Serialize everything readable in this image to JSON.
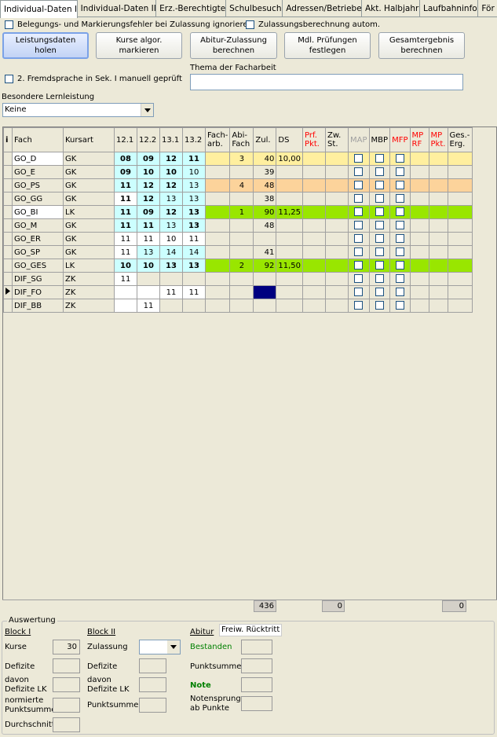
{
  "tabs": [
    "Individual-Daten I",
    "Individual-Daten II",
    "Erz.-Berechtigte",
    "Schulbesuch",
    "Adressen/Betriebe",
    "Akt. Halbjahr",
    "Laufbahninfo",
    "För"
  ],
  "options": {
    "ignore_errors": "Belegungs- und Markierungsfehler bei Zulassung ignorieren",
    "auto_calc": "Zulassungsberechnung autom."
  },
  "buttons": {
    "fetch": "Leistungsdaten holen",
    "mark_l1": "Kurse algor.",
    "mark_l2": "markieren",
    "admission_l1": "Abitur-Zulassung",
    "admission_l2": "berechnen",
    "oral_l1": "Mdl. Prüfungen",
    "oral_l2": "festlegen",
    "total_l1": "Gesamtergebnis",
    "total_l2": "berechnen"
  },
  "thesis_label": "Thema der Facharbeit",
  "thesis_value": "",
  "second_lang": "2. Fremdsprache in Sek. I manuell geprüft",
  "special_label": "Besondere Lernleistung",
  "special_value": "Keine",
  "grid": {
    "headers": {
      "i": "i",
      "fach": "Fach",
      "kursart": "Kursart",
      "h121": "12.1",
      "h122": "12.2",
      "h131": "13.1",
      "h132": "13.2",
      "facharb_1": "Fach-",
      "facharb_2": "arb.",
      "abifach_1": "Abi-",
      "abifach_2": "Fach",
      "zul": "Zul.",
      "ds": "DS",
      "prf_1": "Prf.",
      "prf_2": "Pkt.",
      "zw_1": "Zw.",
      "zw_2": "St.",
      "map": "MAP",
      "mbp": "MBP",
      "mfp": "MFP",
      "mprf_1": "MP",
      "mprf_2": "RF",
      "mppkt_1": "MP",
      "mppkt_2": "Pkt.",
      "ges_1": "Ges.-",
      "ges_2": "Erg."
    },
    "rows": [
      {
        "fach": "GO_D",
        "kursart": "GK",
        "g1": "08",
        "g2": "09",
        "g3": "12",
        "g4": "11",
        "facharb": "",
        "abi": "3",
        "zul": "40",
        "ds": "10,00"
      },
      {
        "fach": "GO_E",
        "kursart": "GK",
        "g1": "09",
        "g2": "10",
        "g3": "10",
        "g4": "10",
        "facharb": "",
        "abi": "",
        "zul": "39",
        "ds": ""
      },
      {
        "fach": "GO_PS",
        "kursart": "GK",
        "g1": "11",
        "g2": "12",
        "g3": "12",
        "g4": "13",
        "facharb": "",
        "abi": "4",
        "zul": "48",
        "ds": ""
      },
      {
        "fach": "GO_GG",
        "kursart": "GK",
        "g1": "11",
        "g2": "12",
        "g3": "13",
        "g4": "13",
        "facharb": "",
        "abi": "",
        "zul": "38",
        "ds": ""
      },
      {
        "fach": "GO_BI",
        "kursart": "LK",
        "g1": "11",
        "g2": "09",
        "g3": "12",
        "g4": "13",
        "facharb": "",
        "abi": "1",
        "zul": "90",
        "ds": "11,25"
      },
      {
        "fach": "GO_M",
        "kursart": "GK",
        "g1": "11",
        "g2": "11",
        "g3": "13",
        "g4": "13",
        "facharb": "",
        "abi": "",
        "zul": "48",
        "ds": ""
      },
      {
        "fach": "GO_ER",
        "kursart": "GK",
        "g1": "11",
        "g2": "11",
        "g3": "10",
        "g4": "11",
        "facharb": "",
        "abi": "",
        "zul": "",
        "ds": ""
      },
      {
        "fach": "GO_SP",
        "kursart": "GK",
        "g1": "11",
        "g2": "13",
        "g3": "14",
        "g4": "14",
        "facharb": "",
        "abi": "",
        "zul": "41",
        "ds": ""
      },
      {
        "fach": "GO_GES",
        "kursart": "LK",
        "g1": "10",
        "g2": "10",
        "g3": "13",
        "g4": "13",
        "facharb": "",
        "abi": "2",
        "zul": "92",
        "ds": "11,50"
      },
      {
        "fach": "DIF_SG",
        "kursart": "ZK",
        "g1": "11",
        "g2": "",
        "g3": "",
        "g4": "",
        "facharb": "",
        "abi": "",
        "zul": "",
        "ds": ""
      },
      {
        "fach": "DIF_FO",
        "kursart": "ZK",
        "g1": "",
        "g2": "",
        "g3": "11",
        "g4": "11",
        "facharb": "",
        "abi": "",
        "zul": "",
        "ds": ""
      },
      {
        "fach": "DIF_BB",
        "kursart": "ZK",
        "g1": "",
        "g2": "11",
        "g3": "",
        "g4": "",
        "facharb": "",
        "abi": "",
        "zul": "",
        "ds": ""
      }
    ],
    "sum_zul": "436",
    "sum_zw": "0",
    "sum_ges": "0"
  },
  "evaluation": {
    "title": "Auswertung",
    "block1": "Block I",
    "kurse": "Kurse",
    "kurse_value": "30",
    "defizite": "Defizite",
    "davon1": "davon",
    "davon2": "Defizite LK",
    "norm1": "normierte",
    "norm2": "Punktsumme",
    "avg": "Durchschnitt",
    "block2": "Block II",
    "zulassung": "Zulassung",
    "defizite2": "Defizite",
    "davon2a": "davon",
    "davon2b": "Defizite LK",
    "punktsumme2": "Punktsumme",
    "abitur": "Abitur",
    "freiw": "Freiw. Rücktritt",
    "bestanden": "Bestanden",
    "punktsumme3": "Punktsumme",
    "note": "Note",
    "sprung1": "Notensprung",
    "sprung2": "ab Punkte"
  },
  "colors": {
    "yellow": "#ffef9f",
    "orange": "#fcd39b",
    "green": "#99e600",
    "cyan": "#ccffff",
    "navy": "#000080"
  }
}
